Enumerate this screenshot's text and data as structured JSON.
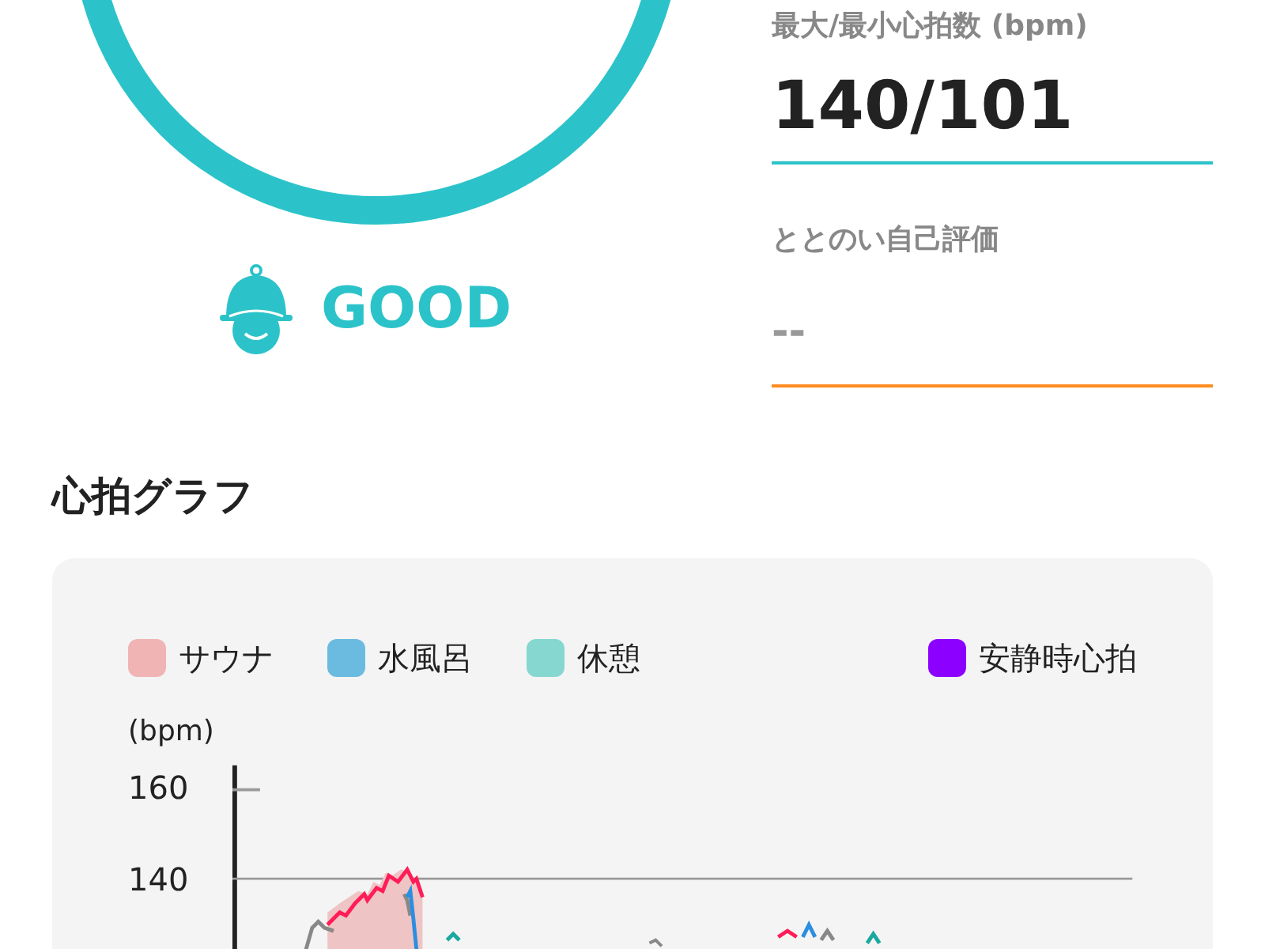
{
  "score": {
    "rating": "GOOD"
  },
  "stats": [
    {
      "label": "最大/最小心拍数 (bpm)",
      "value": "140/101",
      "kind": "filled"
    },
    {
      "label": "ととのい自己評価",
      "value": "--",
      "kind": "empty"
    }
  ],
  "graph": {
    "title": "心拍グラフ",
    "legend": [
      {
        "label": "サウナ",
        "color": "#f0b4b4"
      },
      {
        "label": "水風呂",
        "color": "#6bbbe0"
      },
      {
        "label": "休憩",
        "color": "#86d7cf"
      },
      {
        "label": "安静時心拍",
        "color": "#8b00ff"
      }
    ],
    "unit": "(bpm)",
    "yticks": [
      "160",
      "140"
    ]
  }
}
